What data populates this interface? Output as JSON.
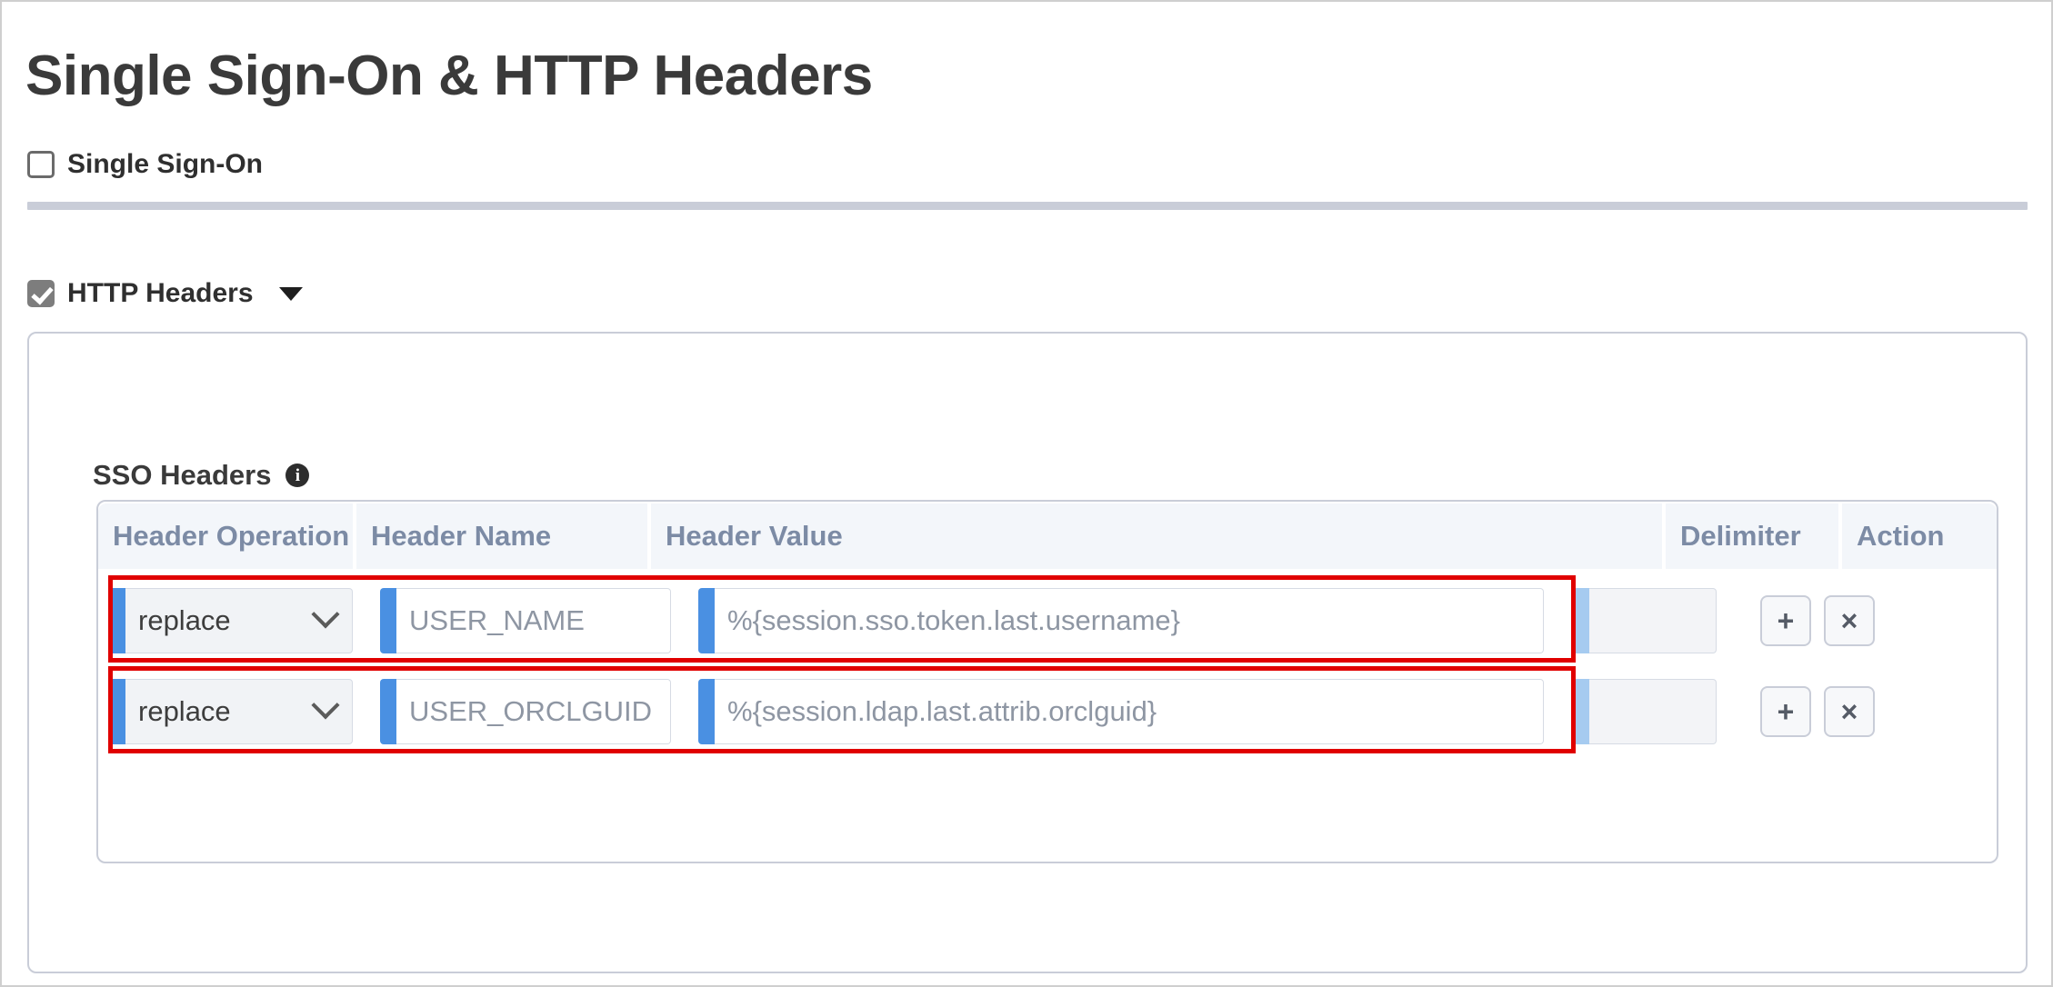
{
  "page": {
    "title": "Single Sign-On & HTTP Headers"
  },
  "sso_section": {
    "label": "Single Sign-On",
    "checked": false
  },
  "http_headers_section": {
    "label": "HTTP Headers",
    "checked": true,
    "caret_icon": "caret-down-icon"
  },
  "sso_headers": {
    "label": "SSO Headers",
    "info_icon": "info-icon",
    "info_glyph": "i",
    "columns": [
      "Header Operation",
      "Header Name",
      "Header Value",
      "Delimiter",
      "Action"
    ],
    "rows": [
      {
        "operation": "replace",
        "name": "USER_NAME",
        "value": "%{session.sso.token.last.username}",
        "delimiter": "",
        "add_label": "+",
        "remove_label": "×",
        "highlighted": true
      },
      {
        "operation": "replace",
        "name": "USER_ORCLGUID",
        "value": "%{session.ldap.last.attrib.orclguid}",
        "delimiter": "",
        "add_label": "+",
        "remove_label": "×",
        "highlighted": true
      }
    ]
  },
  "colors": {
    "accent_blue": "#4a90e2",
    "accent_blue_light": "#a6cbf0",
    "highlight_red": "#e00000",
    "header_text": "#7c8ba5",
    "panel_border": "#c9cdd8"
  }
}
